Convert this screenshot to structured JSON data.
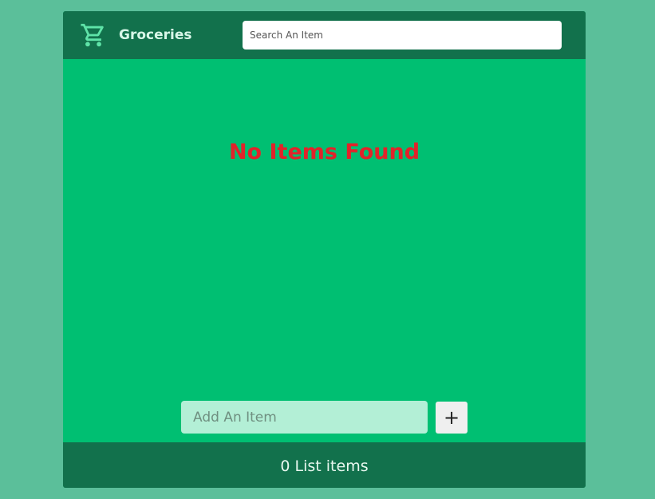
{
  "header": {
    "icon": "shopping-cart-icon",
    "title": "Groceries",
    "search_placeholder": "Search An Item",
    "search_value": ""
  },
  "main": {
    "empty_message": "No Items Found"
  },
  "add_item": {
    "placeholder": "Add An Item",
    "value": "",
    "button_label": "+"
  },
  "footer": {
    "count_text": "0 List items"
  },
  "colors": {
    "page_background": "#5bbf9a",
    "header_footer": "#12714c",
    "main_background": "#00bf72",
    "empty_message": "#e2232a",
    "add_input_background": "#b3efd6"
  }
}
